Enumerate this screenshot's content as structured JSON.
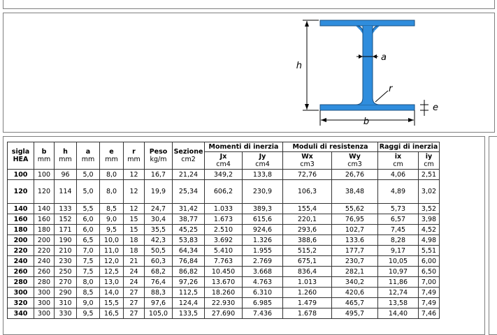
{
  "diagram": {
    "labels": {
      "height": "h",
      "web": "a",
      "radius": "r",
      "flange": "e",
      "base": "b"
    },
    "color": "#2f8ddd"
  },
  "table": {
    "headers": {
      "sigla": "sigla",
      "sigla_sub": "HEA",
      "b": "b",
      "h": "h",
      "a": "a",
      "e": "e",
      "r": "r",
      "mm": "mm",
      "peso": "Peso",
      "peso_unit": "kg/m",
      "sezione": "Sezione",
      "sezione_unit": "cm2",
      "group_momenti": "Momenti di inerzia",
      "group_moduli": "Moduli di resistenza",
      "group_raggi": "Raggi di inerzia",
      "jx": "Jx",
      "jy": "Jy",
      "cm4": "cm4",
      "wx": "Wx",
      "wy": "Wy",
      "cm3": "cm3",
      "ix": "ix",
      "iy": "iy",
      "cm": "cm"
    },
    "rows": [
      [
        "100",
        "100",
        "96",
        "5,0",
        "8,0",
        "12",
        "16,7",
        "21,24",
        "349,2",
        "133,8",
        "72,76",
        "26,76",
        "4,06",
        "2,51"
      ],
      [
        "120",
        "120",
        "114",
        "5,0",
        "8,0",
        "12",
        "19,9",
        "25,34",
        "606,2",
        "230,9",
        "106,3",
        "38,48",
        "4,89",
        "3,02"
      ],
      [
        "140",
        "140",
        "133",
        "5,5",
        "8,5",
        "12",
        "24,7",
        "31,42",
        "1.033",
        "389,3",
        "155,4",
        "55,62",
        "5,73",
        "3,52"
      ],
      [
        "160",
        "160",
        "152",
        "6,0",
        "9,0",
        "15",
        "30,4",
        "38,77",
        "1.673",
        "615,6",
        "220,1",
        "76,95",
        "6,57",
        "3,98"
      ],
      [
        "180",
        "180",
        "171",
        "6,0",
        "9,5",
        "15",
        "35,5",
        "45,25",
        "2.510",
        "924,6",
        "293,6",
        "102,7",
        "7,45",
        "4,52"
      ],
      [
        "200",
        "200",
        "190",
        "6,5",
        "10,0",
        "18",
        "42,3",
        "53,83",
        "3.692",
        "1.326",
        "388,6",
        "133.6",
        "8,28",
        "4,98"
      ],
      [
        "220",
        "220",
        "210",
        "7,0",
        "11,0",
        "18",
        "50,5",
        "64,34",
        "5.410",
        "1.955",
        "515,2",
        "177,7",
        "9,17",
        "5,51"
      ],
      [
        "240",
        "240",
        "230",
        "7,5",
        "12,0",
        "21",
        "60,3",
        "76,84",
        "7.763",
        "2.769",
        "675,1",
        "230,7",
        "10,05",
        "6,00"
      ],
      [
        "260",
        "260",
        "250",
        "7,5",
        "12,5",
        "24",
        "68,2",
        "86,82",
        "10.450",
        "3.668",
        "836,4",
        "282,1",
        "10,97",
        "6,50"
      ],
      [
        "280",
        "280",
        "270",
        "8,0",
        "13,0",
        "24",
        "76,4",
        "97,26",
        "13.670",
        "4.763",
        "1.013",
        "340,2",
        "11,86",
        "7,00"
      ],
      [
        "300",
        "300",
        "290",
        "8,5",
        "14,0",
        "27",
        "88,3",
        "112,5",
        "18.260",
        "6.310",
        "1.260",
        "420,6",
        "12,74",
        "7,49"
      ],
      [
        "320",
        "300",
        "310",
        "9,0",
        "15,5",
        "27",
        "97,6",
        "124,4",
        "22.930",
        "6.985",
        "1.479",
        "465,7",
        "13,58",
        "7,49"
      ],
      [
        "340",
        "300",
        "330",
        "9,5",
        "16,5",
        "27",
        "105,0",
        "133,5",
        "27.690",
        "7.436",
        "1.678",
        "495,7",
        "14,40",
        "7,46"
      ]
    ]
  }
}
